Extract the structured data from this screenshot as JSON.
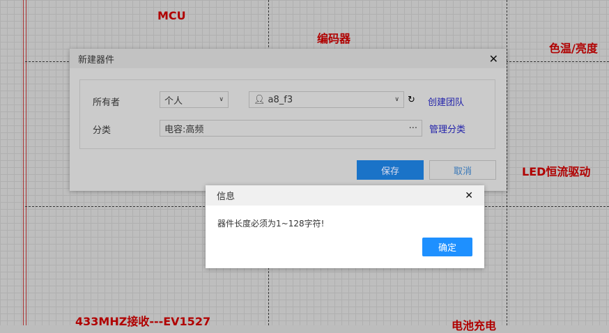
{
  "schematic": {
    "labels": {
      "mcu": "MCU",
      "encoder": "编码器",
      "color_temp": "色温/亮度",
      "led_driver": "LED恒流驱动",
      "receiver": "433MHZ接收---EV1527",
      "battery": "电池充电"
    }
  },
  "new_part_dialog": {
    "title": "新建器件",
    "owner_label": "所有者",
    "owner_type": "个人",
    "owner_user": "a8_f3",
    "create_team": "创建团队",
    "category_label": "分类",
    "category_value": "电容:高频",
    "category_more": "···",
    "manage_category": "管理分类",
    "save": "保存",
    "cancel": "取消"
  },
  "info_dialog": {
    "title": "信息",
    "message": "器件长度必须为1~128字符!",
    "ok": "确定"
  },
  "colors": {
    "primary": "#1e90ff",
    "label_red": "#b00000"
  }
}
